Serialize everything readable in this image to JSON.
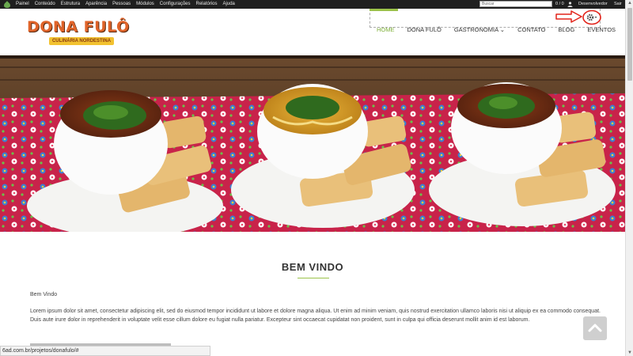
{
  "adminbar": {
    "menu": [
      "Painel",
      "Conteúdo",
      "Estrutura",
      "Aparência",
      "Pessoas",
      "Módulos",
      "Configurações",
      "Relatórios",
      "Ajuda"
    ],
    "search_placeholder": "Buscar",
    "counter": "0 / 0",
    "user": "Desenvolvedor",
    "logout": "Sair"
  },
  "brand": {
    "title": "DONA FULÔ",
    "tagline": "CULINÁRIA NORDESTINA"
  },
  "nav": {
    "items": [
      "HOME",
      "DONA FULÔ",
      "GASTRONOMIA ⌄",
      "CONTATO",
      "BLOG",
      "EVENTOS"
    ]
  },
  "content": {
    "heading": "BEM VINDO",
    "subtitle": "Bem Vindo",
    "body": "Lorem ipsum dolor sit amet, consectetur adipiscing elit, sed do eiusmod tempor incididunt ut labore et dolore magna aliqua. Ut enim ad minim veniam, quis nostrud exercitation ullamco laboris nisi ut aliquip ex ea commodo consequat. Duis aute irure dolor in reprehenderit in voluptate velit esse cillum dolore eu fugiat nulla pariatur. Excepteur sint occaecat cupidatat non proident, sunt in culpa qui officia deserunt mollit anim id est laborum."
  },
  "statusbar": {
    "url": "6ad.com.br/projetos/donafulo/#"
  },
  "colors": {
    "accent": "#7fb03a",
    "brand": "#e0642a",
    "adminbar": "#1f1f1f",
    "annotation": "#e2231a"
  }
}
